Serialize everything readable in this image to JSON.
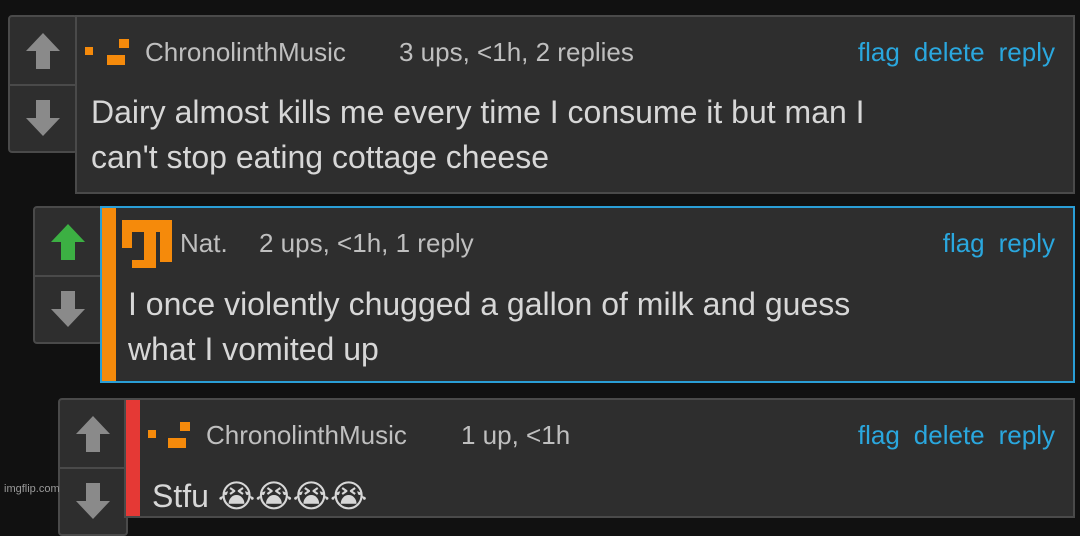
{
  "comments": [
    {
      "username": "ChronolinthMusic",
      "meta": "3 ups, <1h, 2 replies",
      "actions": [
        "flag",
        "delete",
        "reply"
      ],
      "text_lines": [
        "Dairy almost kills me every time I consume it but man I",
        "can't stop eating cottage cheese"
      ],
      "upvoted": false
    },
    {
      "username": "Nat.",
      "meta": "2 ups, <1h, 1 reply",
      "actions": [
        "flag",
        "reply"
      ],
      "text_lines": [
        "I once violently chugged a gallon of milk and guess",
        "what I vomited up"
      ],
      "upvoted": true,
      "bar_color": "#f58a0b"
    },
    {
      "username": "ChronolinthMusic",
      "meta": "1 up, <1h",
      "actions": [
        "flag",
        "delete",
        "reply"
      ],
      "text_lines": [
        "Stfu 😭😭😭😭"
      ],
      "upvoted": false,
      "bar_color": "#e53935"
    }
  ],
  "watermark": "imgflip.com",
  "colors": {
    "link": "#2aa7de",
    "upvote_active": "#3cb043",
    "arrow_default": "#8a8a8a",
    "avatar_orange": "#f58a0b"
  }
}
